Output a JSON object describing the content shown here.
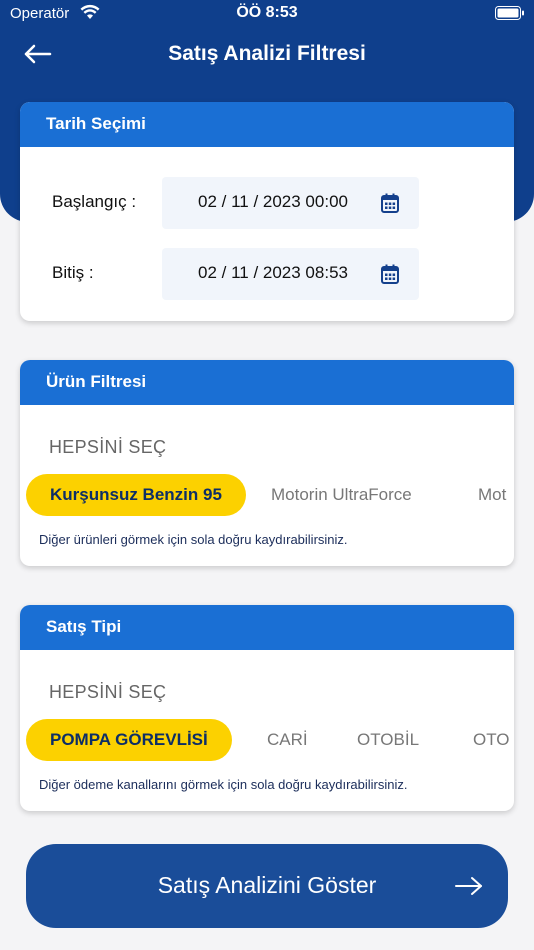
{
  "status_bar": {
    "carrier": "Operatör",
    "time": "ÖÖ 8:53",
    "icons": [
      "wifi-icon",
      "battery-icon"
    ]
  },
  "nav": {
    "title": "Satış Analizi Filtresi",
    "back_icon": "arrow-left-icon"
  },
  "colors": {
    "header_bg": "#0f3f8c",
    "card_header": "#1a6fd4",
    "chip_active": "#fcd100",
    "button_bg": "#1a4d99"
  },
  "date_section": {
    "title": "Tarih Seçimi",
    "start": {
      "label": "Başlangıç :",
      "value": "02 / 11 / 2023 00:00"
    },
    "end": {
      "label": "Bitiş :",
      "value": "02 / 11 / 2023 08:53"
    },
    "icon": "calendar-icon"
  },
  "product_section": {
    "title": "Ürün Filtresi",
    "select_all": "HEPSİNİ SEÇ",
    "chips": [
      {
        "label": "Kurşunsuz Benzin 95",
        "active": true
      },
      {
        "label": "Motorin UltraForce",
        "active": false
      },
      {
        "label": "Mot",
        "active": false
      }
    ],
    "hint": "Diğer ürünleri görmek için sola doğru kaydırabilirsiniz."
  },
  "sales_section": {
    "title": "Satış Tipi",
    "select_all": "HEPSİNİ SEÇ",
    "chips": [
      {
        "label": "POMPA GÖREVLİSİ",
        "active": true
      },
      {
        "label": "CARİ",
        "active": false
      },
      {
        "label": "OTOBİL",
        "active": false
      },
      {
        "label": "OTO",
        "active": false
      }
    ],
    "hint": "Diğer ödeme kanallarını görmek için sola doğru kaydırabilirsiniz."
  },
  "submit": {
    "label": "Satış Analizini Göster",
    "icon": "arrow-right-icon"
  }
}
